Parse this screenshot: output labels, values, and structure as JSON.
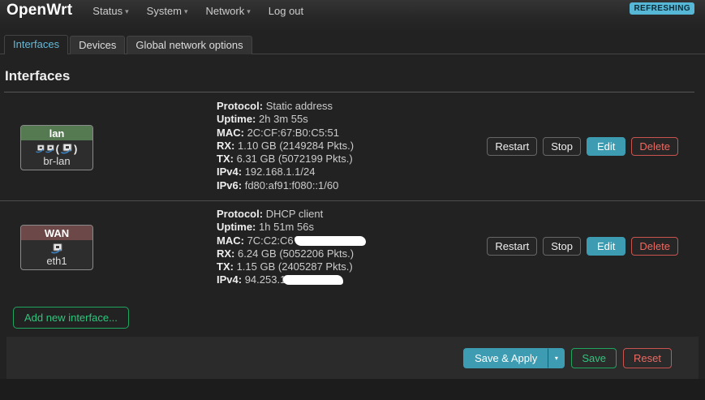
{
  "header": {
    "brand": "OpenWrt",
    "nav": [
      {
        "label": "Status",
        "has_dropdown": true
      },
      {
        "label": "System",
        "has_dropdown": true
      },
      {
        "label": "Network",
        "has_dropdown": true
      },
      {
        "label": "Log out",
        "has_dropdown": false
      }
    ],
    "refresh_badge": "REFRESHING"
  },
  "tabs": [
    {
      "label": "Interfaces",
      "active": true
    },
    {
      "label": "Devices",
      "active": false
    },
    {
      "label": "Global network options",
      "active": false
    }
  ],
  "main": {
    "title": "Interfaces"
  },
  "interfaces": [
    {
      "name": "lan",
      "device": "br-lan",
      "type": "bridge",
      "header_color": "#557a52",
      "details": [
        {
          "label": "Protocol:",
          "value": "Static address"
        },
        {
          "label": "Uptime:",
          "value": "2h 3m 55s"
        },
        {
          "label": "MAC:",
          "value": "2C:CF:67:B0:C5:51"
        },
        {
          "label": "RX:",
          "value": "1.10 GB (2149284 Pkts.)"
        },
        {
          "label": "TX:",
          "value": "6.31 GB (5072199 Pkts.)"
        },
        {
          "label": "IPv4:",
          "value": "192.168.1.1/24"
        },
        {
          "label": "IPv6:",
          "value": "fd80:af91:f080::1/60"
        }
      ]
    },
    {
      "name": "WAN",
      "device": "eth1",
      "type": "ethernet",
      "header_color": "#6d4848",
      "details": [
        {
          "label": "Protocol:",
          "value": "DHCP client"
        },
        {
          "label": "Uptime:",
          "value": "1h 51m 56s"
        },
        {
          "label": "MAC:",
          "value": "7C:C2:C6",
          "redacted": true
        },
        {
          "label": "RX:",
          "value": "6.24 GB (5052206 Pkts.)"
        },
        {
          "label": "TX:",
          "value": "1.15 GB (2405287 Pkts.)"
        },
        {
          "label": "IPv4:",
          "value": "94.253.1",
          "redacted": true
        }
      ]
    }
  ],
  "actions": {
    "restart": "Restart",
    "stop": "Stop",
    "edit": "Edit",
    "delete": "Delete"
  },
  "add_button": "Add new interface...",
  "footer": {
    "save_apply": "Save & Apply",
    "save": "Save",
    "reset": "Reset"
  },
  "icons": {
    "caret": "▾"
  },
  "colors": {
    "badge_bg": "#56b7d6",
    "accent_teal": "#3d9cb2",
    "accent_green": "#2fc57d",
    "accent_red": "#ec6a62",
    "lan_header": "#557a52",
    "wan_header": "#6d4848"
  }
}
